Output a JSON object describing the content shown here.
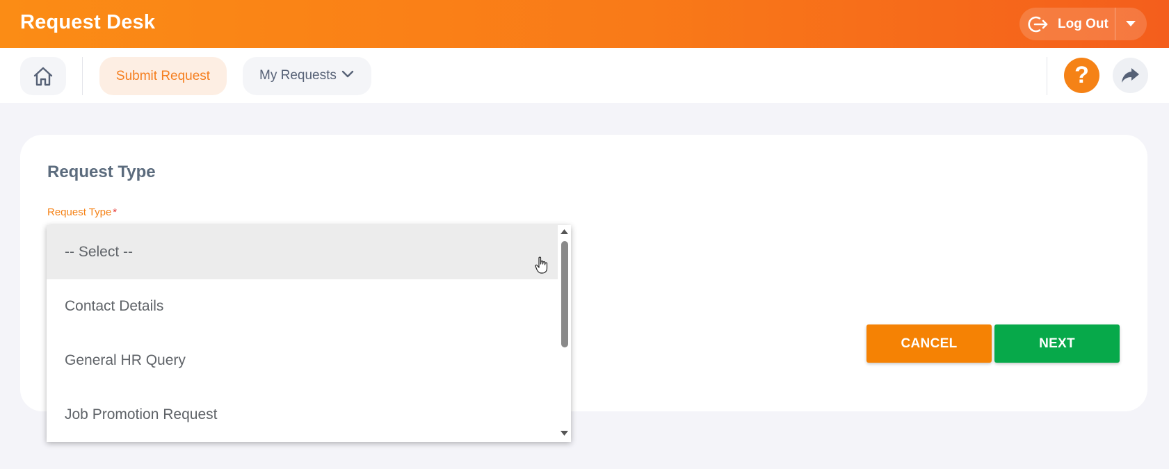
{
  "header": {
    "app_title": "Request Desk",
    "logout_label": "Log Out",
    "gradient_from": "#fb8c15",
    "gradient_to": "#f45e1c"
  },
  "nav": {
    "home_icon": "home-icon",
    "submit_request_label": "Submit Request",
    "my_requests_label": "My Requests",
    "help_label": "?",
    "share_icon": "share-arrow-icon",
    "accent_color": "#f58216"
  },
  "form": {
    "section_title": "Request Type",
    "field_label": "Request Type",
    "required_marker": "*",
    "cancel_label": "CANCEL",
    "next_label": "NEXT",
    "cancel_color": "#f58204",
    "next_color": "#07a94a"
  },
  "dropdown": {
    "options": [
      {
        "label": "-- Select --",
        "hovered": true
      },
      {
        "label": "Contact Details",
        "hovered": false
      },
      {
        "label": "General HR Query",
        "hovered": false
      },
      {
        "label": "Job Promotion Request",
        "hovered": false
      }
    ],
    "scroll_position_fraction": 0.0
  }
}
